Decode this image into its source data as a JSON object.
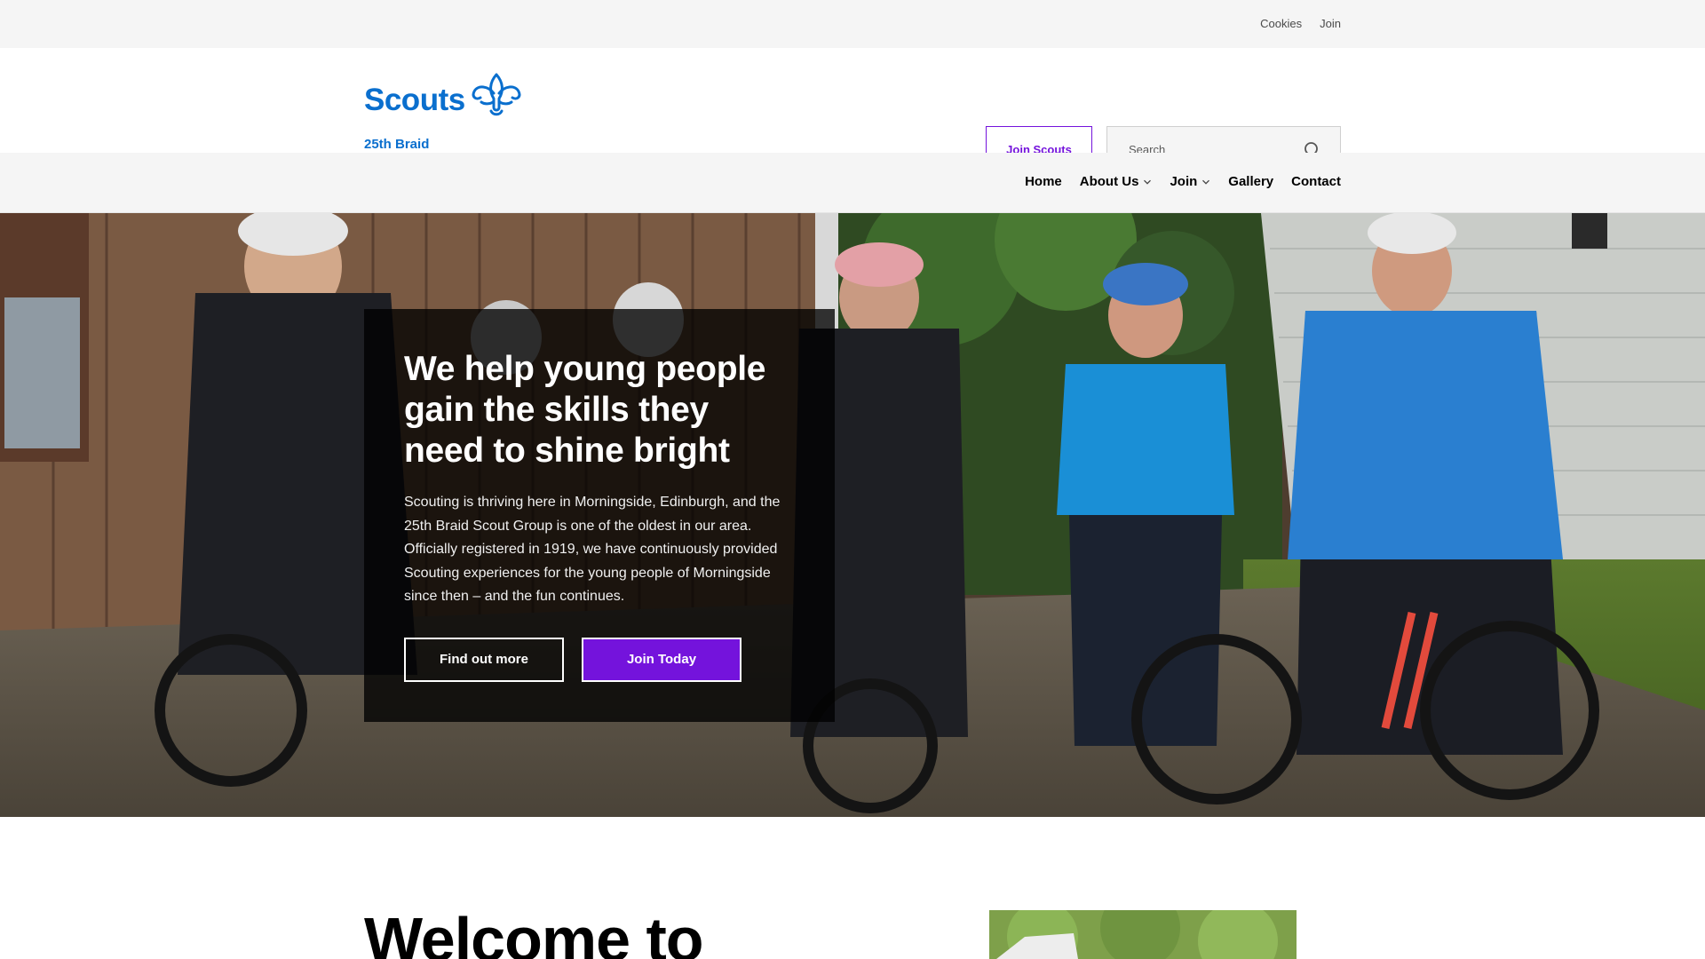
{
  "utility": {
    "links": [
      "Cookies",
      "Join"
    ]
  },
  "header": {
    "logo_text": "Scouts",
    "logo_subtitle": "25th Braid",
    "join_button": "Join Scouts",
    "search_placeholder": "Search"
  },
  "nav": {
    "items": [
      {
        "label": "Home",
        "dropdown": false
      },
      {
        "label": "About Us",
        "dropdown": true
      },
      {
        "label": "Join",
        "dropdown": true
      },
      {
        "label": "Gallery",
        "dropdown": false
      },
      {
        "label": "Contact",
        "dropdown": false
      }
    ]
  },
  "hero": {
    "title": "We help young people gain the skills they need to shine bright",
    "body": "Scouting is thriving here in Morningside, Edinburgh, and the 25th Braid Scout Group is one of the oldest in our area. Officially registered in 1919, we have continuously provided Scouting experiences for the young people of Morningside since then – and the fun continues.",
    "primary_button": "Find out more",
    "secondary_button": "Join Today"
  },
  "welcome": {
    "heading": "Welcome to"
  },
  "colors": {
    "brand_blue": "#0a6fce",
    "brand_purple": "#7413dc",
    "bar_grey": "#f5f5f5"
  },
  "icons": [
    "fleur-de-lis-logo-icon",
    "search-icon",
    "chevron-down-icon"
  ]
}
